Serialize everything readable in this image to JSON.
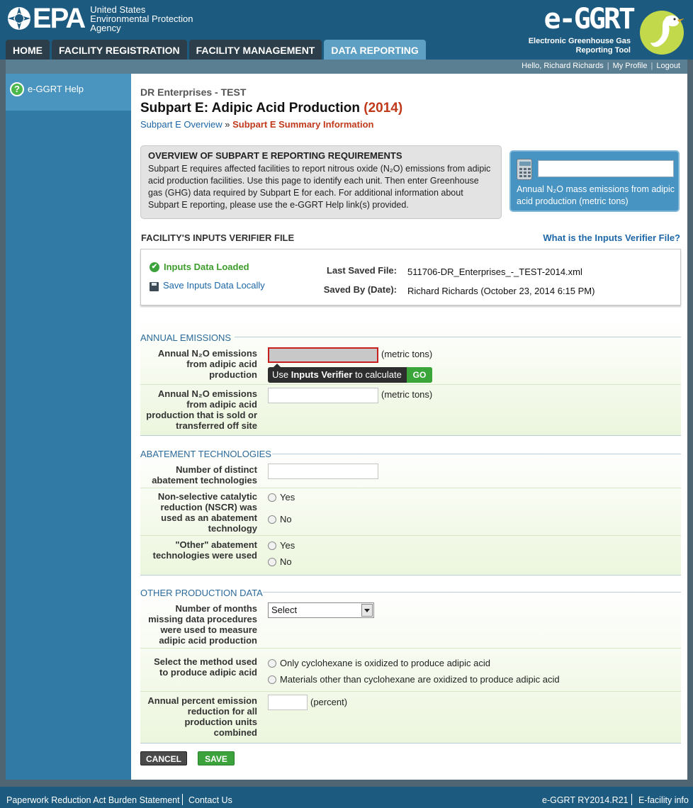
{
  "header": {
    "agency_name": "United States Environmental Protection Agency",
    "agency_lines": [
      "United States",
      "Environmental Protection",
      "Agency"
    ],
    "epa_logo_text": "EPA",
    "app_logo": "e-GGRT",
    "app_subtitle_lines": [
      "Electronic Greenhouse Gas",
      "Reporting Tool"
    ]
  },
  "nav": {
    "tabs": [
      {
        "label": "HOME"
      },
      {
        "label": "FACILITY REGISTRATION"
      },
      {
        "label": "FACILITY MANAGEMENT"
      },
      {
        "label": "DATA REPORTING"
      }
    ],
    "active": "DATA REPORTING"
  },
  "userbar": {
    "greeting": "Hello, Richard Richards",
    "profile": "My Profile",
    "logout": "Logout"
  },
  "sidebar": {
    "help_label": "e-GGRT Help",
    "help_icon": "?"
  },
  "main": {
    "company": "DR Enterprises - TEST",
    "title": "Subpart E: Adipic Acid Production",
    "year": "(2014)",
    "breadcrumb_link": "Subpart E Overview",
    "breadcrumb_sep": "»",
    "breadcrumb_current": "Subpart E Summary Information",
    "overview_title": "OVERVIEW OF SUBPART E REPORTING REQUIREMENTS",
    "overview_text": "Subpart E requires affected facilities to report nitrous oxide (N₂O) emissions from adipic acid production facilities. Use this page to identify each unit. Then enter Greenhouse gas (GHG) data required by Subpart E for each. For additional information about Subpart E reporting, please use the e-GGRT Help link(s) provided.",
    "calc_label": "Annual N₂O mass emissions from adipic acid production (metric tons)",
    "inputs_header": "FACILITY'S INPUTS VERIFIER FILE",
    "what_verifier": "What is the Inputs Verifier File?",
    "inputs_loaded": "Inputs Data Loaded",
    "save_locally": "Save Inputs Data Locally",
    "last_saved_label": "Last Saved File:",
    "last_saved_value": "511706-DR_Enterprises_-_TEST-2014.xml",
    "saved_by_label": "Saved By (Date):",
    "saved_by_value": "Richard Richards (October 23, 2014 6:15 PM)"
  },
  "annual": {
    "title": "ANNUAL EMISSIONS",
    "f1_label": "Annual N₂O emissions from adipic acid production",
    "f1_unit": "(metric tons)",
    "tooltip_pre": "Use ",
    "tooltip_bold": "Inputs Verifier",
    "tooltip_post": " to calculate",
    "go": "GO",
    "f2_label": "Annual N₂O emissions from adipic acid production that is sold or transferred off site",
    "f2_unit": "(metric tons)"
  },
  "abatement": {
    "title": "ABATEMENT TECHNOLOGIES",
    "f1_label": "Number of distinct abatement technologies",
    "f2_label": "Non-selective catalytic reduction (NSCR) was used as an abatement technology",
    "f3_label": "\"Other\" abatement technologies were used",
    "yes": "Yes",
    "no": "No"
  },
  "other": {
    "title": "OTHER PRODUCTION DATA",
    "f1_label": "Number of months missing data procedures were used to measure adipic acid production",
    "f1_select": "Select",
    "f2_label": "Select the method used to produce adipic acid",
    "f2_opt1": "Only cyclohexane is oxidized to produce adipic acid",
    "f2_opt2": "Materials other than cyclohexane are oxidized to produce adipic acid",
    "f3_label": "Annual percent emission reduction for all production units combined",
    "f3_unit": "(percent)"
  },
  "buttons": {
    "cancel": "CANCEL",
    "save": "SAVE"
  },
  "footer": {
    "paperwork": "Paperwork Reduction Act Burden Statement",
    "contact": "Contact Us",
    "version": "e-GGRT RY2014.R21",
    "efacility": "E-facility info"
  },
  "colors": {
    "header_bg": "#1c5a7f",
    "accent_red": "#c0391b",
    "link_blue": "#1d67a8",
    "go_green": "#3aa63a"
  }
}
